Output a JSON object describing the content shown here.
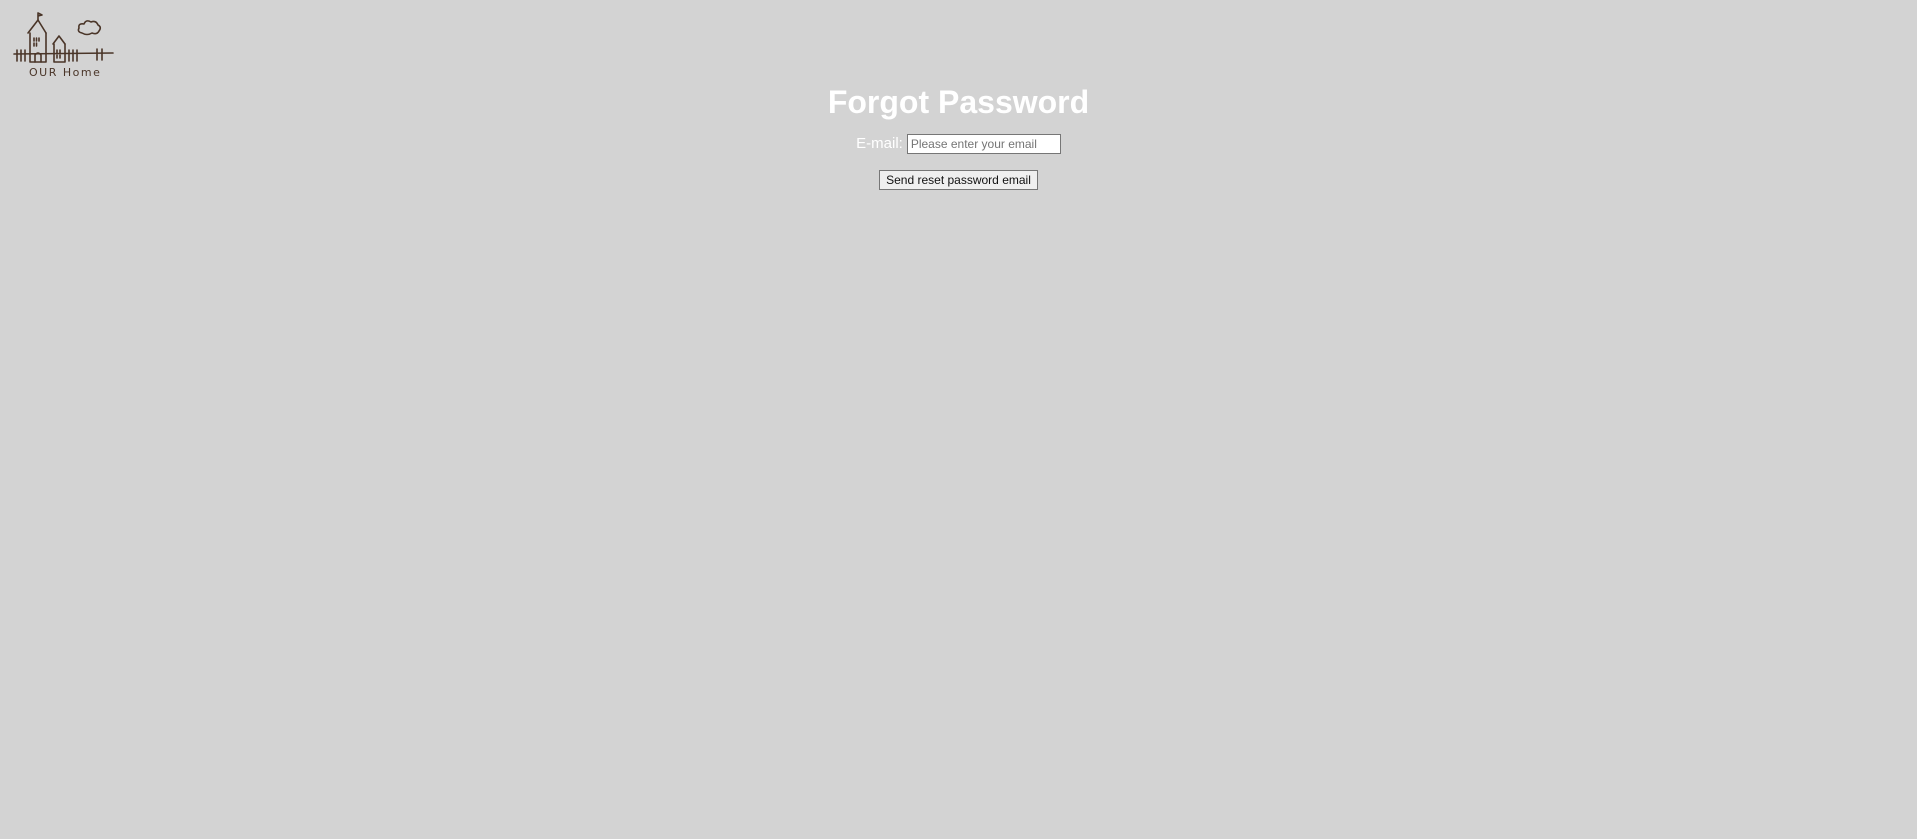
{
  "logo": {
    "text": "OUR Home",
    "icon": "houses-logo-icon"
  },
  "header": {
    "title": "Forgot Password"
  },
  "form": {
    "email_label": "E-mail:",
    "email_value": "",
    "email_placeholder": "Please enter your email",
    "submit_label": "Send reset password email"
  },
  "colors": {
    "background": "#d3d3d3",
    "title": "#ffffff",
    "logo_ink": "#4a3528"
  }
}
